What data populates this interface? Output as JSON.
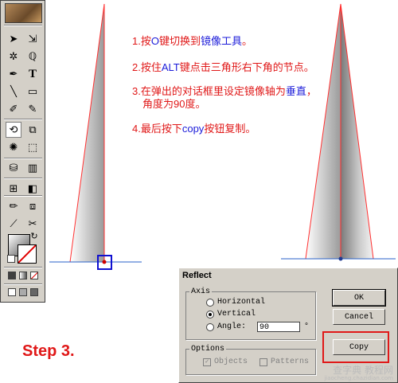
{
  "instructions": {
    "step1_a": "1.按",
    "step1_key": "O",
    "step1_b": "键切换到",
    "step1_tool": "镜像工具",
    "step1_c": "。",
    "step2_a": "2.按住",
    "step2_key": "ALT",
    "step2_b": "键点击三角形右下角的节点。",
    "step3_a": "3.在弹出的对话框里设定镜像轴为",
    "step3_axis": "垂直",
    "step3_b": "，",
    "step3_c": "角度为90度。",
    "step4_a": "4.最后按下",
    "step4_btn": "copy",
    "step4_b": "按钮复制。"
  },
  "step_title": "Step 3.",
  "dialog": {
    "title": "Reflect",
    "axis_legend": "Axis",
    "horizontal_label": "Horizontal",
    "vertical_label": "Vertical",
    "angle_label": "Angle:",
    "angle_value": "90",
    "degree_symbol": "°",
    "options_legend": "Options",
    "objects_label": "Objects",
    "patterns_label": "Patterns",
    "ok_label": "OK",
    "cancel_label": "Cancel",
    "copy_label": "Copy",
    "selected_axis": "vertical"
  },
  "toolbox_icons": [
    "selection-tool",
    "direct-selection-tool",
    "magic-wand-tool",
    "lasso-tool",
    "pen-tool",
    "type-tool",
    "line-tool",
    "rectangle-tool",
    "paintbrush-tool",
    "pencil-tool",
    "reflect-tool",
    "scale-tool",
    "warp-tool",
    "free-transform-tool",
    "symbol-sprayer-tool",
    "graph-tool",
    "mesh-tool",
    "gradient-tool",
    "eyedropper-tool",
    "blend-tool",
    "slice-tool",
    "scissors-tool",
    "hand-tool",
    "zoom-tool"
  ],
  "watermark": {
    "line1": "查字典 教程网",
    "line2": "jiaocheng.chazidian.com"
  },
  "colors": {
    "instruction_red": "#e01818",
    "highlight_blue": "#1b1bd9",
    "path_red": "#ff3030",
    "guide_blue": "#2a62c8",
    "dialog_gray": "#d4d0c8"
  }
}
